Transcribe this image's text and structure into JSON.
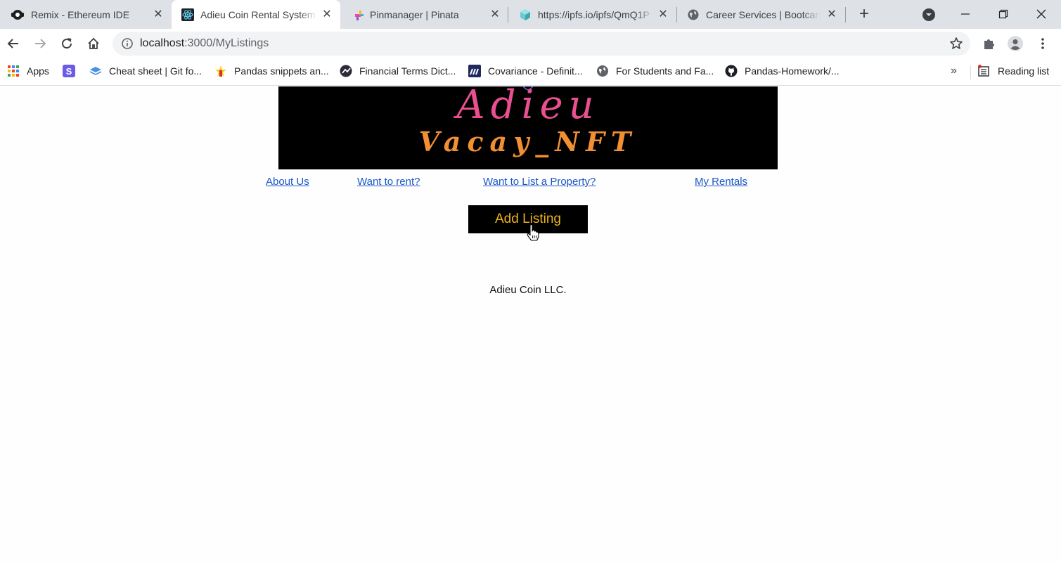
{
  "browser": {
    "tabs": [
      {
        "title": "Remix - Ethereum IDE",
        "icon": "remix-icon",
        "active": false
      },
      {
        "title": "Adieu Coin Rental System",
        "icon": "react-icon",
        "active": true
      },
      {
        "title": "Pinmanager | Pinata",
        "icon": "pinata-icon",
        "active": false
      },
      {
        "title": "https://ipfs.io/ipfs/QmQ1P",
        "icon": "ipfs-cube-icon",
        "active": false
      },
      {
        "title": "Career Services | Bootcamp",
        "icon": "globe-icon",
        "active": false
      }
    ],
    "address": {
      "host": "localhost",
      "path": ":3000/MyListings"
    },
    "bookmarks": [
      {
        "label": "Apps",
        "icon": "apps-grid-icon"
      },
      {
        "label": "",
        "icon": "s-app-icon"
      },
      {
        "label": "Cheat sheet | Git fo...",
        "icon": "stack-icon"
      },
      {
        "label": "Pandas snippets an...",
        "icon": "pandas-icon"
      },
      {
        "label": "Financial Terms Dict...",
        "icon": "investopedia-icon"
      },
      {
        "label": "Covariance - Definit...",
        "icon": "chart-icon"
      },
      {
        "label": "For Students and Fa...",
        "icon": "globe-icon"
      },
      {
        "label": "Pandas-Homework/...",
        "icon": "github-icon"
      }
    ],
    "reading_list": "Reading list"
  },
  "page": {
    "banner": {
      "line1": "Adieu",
      "line2": "Vacay_NFT"
    },
    "nav": {
      "about": "About Us",
      "rent": "Want to rent?",
      "list": "Want to List a Property?",
      "rentals": "My Rentals"
    },
    "add_listing": "Add Listing",
    "footer": "Adieu Coin LLC."
  },
  "colors": {
    "banner_bg": "#000000",
    "banner_pink": "#ea4f8f",
    "banner_orange": "#f18f33",
    "button_bg": "#000000",
    "button_text": "#f0b41a",
    "link": "#1a57c8"
  }
}
